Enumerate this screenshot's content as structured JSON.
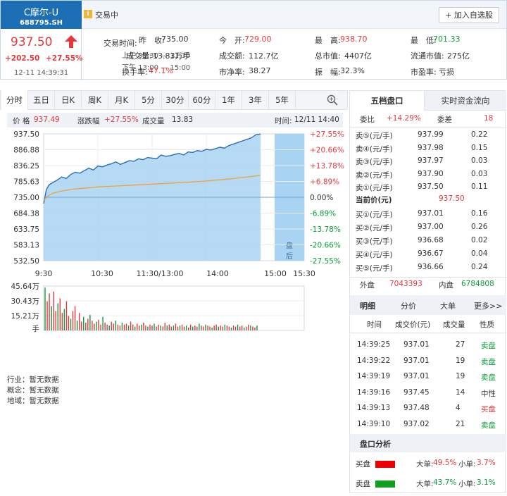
{
  "stock": {
    "name": "C摩尔-U",
    "code": "688795.SH",
    "price": "937.50",
    "change": "+202.50",
    "change_pct": "+27.55%",
    "timestamp": "12-11 14:39:31"
  },
  "status": {
    "icon": "i",
    "label": "交易中"
  },
  "add_button": "+ 加入自选股",
  "quote": {
    "prev_close_label": "昨　收:",
    "prev_close": "735.00",
    "open_label": "今　开:",
    "open": "729.00",
    "high_label": "最　高:",
    "high": "938.70",
    "low_label": "最　低:",
    "low": "701.33",
    "volume_label": "成交量:",
    "volume": "13.83万手",
    "amount_label": "成交额:",
    "amount": "112.7亿",
    "total_mv_label": "总市值:",
    "total_mv": "4407亿",
    "float_mv_label": "流通市值:",
    "float_mv": "275亿",
    "turnover_label": "换手率:",
    "turnover": "47.1%",
    "pb_label": "市净率:",
    "pb": "38.27",
    "amplitude_label": "振　幅:",
    "amplitude": "32.3%",
    "pe_label": "市盈率:",
    "pe": "亏损",
    "trade_time_label": "交易时间:",
    "trade_time_1": "上午 09:30 — 11:30",
    "trade_time_2": "下午 13:00 — 15:00"
  },
  "tabs": [
    "分时",
    "五日",
    "日K",
    "周K",
    "月K",
    "5分",
    "30分",
    "60分",
    "1年",
    "3年",
    "5年"
  ],
  "zoom_icon": "zoom-in-icon",
  "infobar": {
    "price_label": "价 格",
    "price": "937.49",
    "chg_label": "涨跌幅",
    "chg": "+27.55%",
    "vol_label": "成交量",
    "vol": "13.83",
    "time_label": "时间:",
    "time": "12/11 14:40"
  },
  "chart_data": {
    "type": "line",
    "title": "",
    "x_ticks": [
      "9:30",
      "10:30",
      "11:30/13:00",
      "14:00",
      "15:00",
      "15:30"
    ],
    "y_ticks": [
      "937.50",
      "886.88",
      "836.25",
      "785.63",
      "735.00",
      "684.38",
      "633.75",
      "583.13",
      "532.50"
    ],
    "y_pct_ticks": [
      "+27.55%",
      "+20.66%",
      "+13.78%",
      "+6.89%",
      "0.00%",
      "-6.89%",
      "-13.78%",
      "-20.66%",
      "-27.55%"
    ],
    "ylim": [
      532.5,
      937.5
    ],
    "prev_close": 735.0,
    "after_hours_label": [
      "盘",
      "后"
    ],
    "price_series": {
      "name": "price",
      "x": [
        0,
        3,
        6,
        10,
        15,
        20,
        25,
        30,
        35,
        40,
        45,
        50,
        55,
        60,
        65,
        70,
        75,
        80,
        85,
        90,
        95,
        100,
        105,
        110,
        115,
        120,
        125,
        130,
        135,
        140,
        145,
        150,
        155,
        160,
        165,
        170,
        175,
        180,
        185,
        190,
        195,
        200,
        205,
        210,
        215,
        220,
        225,
        230,
        235,
        240
      ],
      "y": [
        715,
        760,
        775,
        782,
        790,
        800,
        795,
        808,
        815,
        812,
        820,
        828,
        822,
        835,
        832,
        838,
        842,
        848,
        840,
        846,
        852,
        850,
        858,
        855,
        862,
        860,
        858,
        870,
        866,
        868,
        872,
        875,
        870,
        880,
        878,
        884,
        882,
        888,
        886,
        890,
        895,
        892,
        900,
        905,
        910,
        915,
        920,
        925,
        935,
        937
      ]
    },
    "avg_series": {
      "name": "avg",
      "x": [
        0,
        5,
        10,
        20,
        30,
        40,
        60,
        80,
        100,
        120,
        140,
        160,
        180,
        200,
        220,
        240
      ],
      "y": [
        725,
        740,
        748,
        755,
        760,
        763,
        768,
        771,
        774,
        777,
        780,
        783,
        787,
        792,
        798,
        805
      ]
    },
    "volume_ticks": [
      "45.64万",
      "30.43万",
      "15.21万",
      "手"
    ],
    "volume_max": 45.64,
    "volume": [
      44,
      30,
      38,
      25,
      40,
      20,
      28,
      33,
      18,
      22,
      30,
      15,
      12,
      20,
      25,
      10,
      18,
      9,
      14,
      8,
      12,
      16,
      10,
      7,
      9,
      11,
      6,
      14,
      8,
      6,
      5,
      9,
      7,
      10,
      6,
      5,
      8,
      6,
      7,
      5,
      9,
      6,
      4,
      7,
      5,
      6,
      8,
      5,
      4,
      6,
      5,
      7,
      4,
      6,
      5,
      4,
      8,
      5,
      6,
      4,
      5,
      7,
      4,
      5,
      6,
      4,
      5,
      3,
      6,
      4,
      5,
      4,
      7,
      5,
      4,
      6,
      5,
      4,
      3,
      5,
      6,
      4,
      5,
      4,
      6,
      5,
      4,
      3,
      5,
      4,
      6,
      4,
      5,
      3,
      4,
      6,
      5,
      4,
      3,
      5
    ]
  },
  "industry": [
    {
      "label": "行业：",
      "value": "暂无数据"
    },
    {
      "label": "概念：",
      "value": "暂无数据"
    },
    {
      "label": "地域：",
      "value": "暂无数据"
    }
  ],
  "right_tabs": [
    "五档盘口",
    "实时资金流向"
  ],
  "order_book": {
    "webi_label": "委比",
    "webi": "+14.29%",
    "weicha_label": "委差",
    "weicha": "18",
    "sells": [
      {
        "label": "卖⑤(元/手)",
        "price": "937.99",
        "vol": "0.22"
      },
      {
        "label": "卖④(元/手)",
        "price": "937.98",
        "vol": "0.15"
      },
      {
        "label": "卖③(元/手)",
        "price": "937.97",
        "vol": "0.03"
      },
      {
        "label": "卖②(元/手)",
        "price": "937.90",
        "vol": "0.03"
      },
      {
        "label": "卖①(元/手)",
        "price": "937.50",
        "vol": "0.11"
      }
    ],
    "current_label": "当前价(元)",
    "current": "937.50",
    "buys": [
      {
        "label": "买①(元/手)",
        "price": "937.01",
        "vol": "0.16"
      },
      {
        "label": "买②(元/手)",
        "price": "937.00",
        "vol": "0.26"
      },
      {
        "label": "买③(元/手)",
        "price": "936.68",
        "vol": "0.02"
      },
      {
        "label": "买④(元/手)",
        "price": "936.67",
        "vol": "0.04"
      },
      {
        "label": "买⑤(元/手)",
        "price": "936.66",
        "vol": "0.24"
      }
    ],
    "outer_label": "外盘",
    "outer": "7043393",
    "inner_label": "内盘",
    "inner": "6784808"
  },
  "detail_tabs": [
    "明细",
    "分价",
    "大单",
    "更多>>"
  ],
  "trade_headers": [
    "时间",
    "成交价(元)",
    "成交量",
    "性质"
  ],
  "trades": [
    {
      "time": "14:39:25",
      "price": "937.01",
      "vol": "27",
      "type": "卖盘",
      "color": "#0a9e3a"
    },
    {
      "time": "14:39:22",
      "price": "937.01",
      "vol": "19",
      "type": "卖盘",
      "color": "#0a9e3a"
    },
    {
      "time": "14:39:19",
      "price": "937.01",
      "vol": "19",
      "type": "卖盘",
      "color": "#0a9e3a"
    },
    {
      "time": "14:39:16",
      "price": "937.45",
      "vol": "14",
      "type": "中性",
      "color": "#333333"
    },
    {
      "time": "14:39:13",
      "price": "937.48",
      "vol": "4",
      "type": "买盘",
      "color": "#e4393c"
    },
    {
      "time": "14:39:10",
      "price": "937.02",
      "vol": "21",
      "type": "卖盘",
      "color": "#0a9e3a"
    }
  ],
  "analysis": {
    "title": "盘口分析",
    "buy_label": "买盘",
    "buy_big_label": "大单:",
    "buy_big": "49.5%",
    "buy_small_label": "小单:",
    "buy_small": "3.7%",
    "sell_label": "卖盘",
    "sell_big_label": "大单:",
    "sell_big": "43.7%",
    "sell_small_label": "小单:",
    "sell_small": "3.1%"
  },
  "colors": {
    "up": "#e4393c",
    "down": "#0a9e3a",
    "brand": "#1d6fb5",
    "area_fill": "#a9d3f2",
    "price_line": "#2a6fb5",
    "avg_line": "#f0a040"
  }
}
